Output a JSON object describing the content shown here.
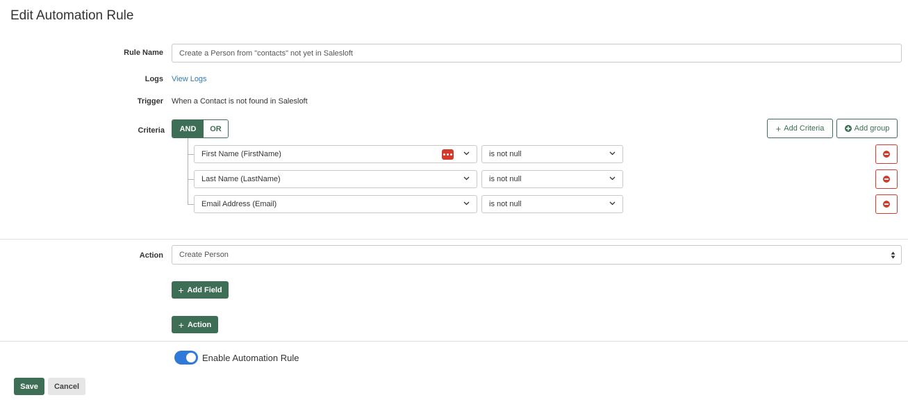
{
  "page": {
    "title": "Edit Automation Rule"
  },
  "rule_name": {
    "label": "Rule Name",
    "value": "Create a Person from \"contacts\" not yet in Salesloft"
  },
  "logs": {
    "label": "Logs",
    "link": "View Logs"
  },
  "trigger": {
    "label": "Trigger",
    "value": "When a Contact is not found in Salesloft"
  },
  "criteria": {
    "label": "Criteria",
    "and_label": "AND",
    "or_label": "OR",
    "selected_operator": "AND",
    "add_criteria_label": "Add Criteria",
    "add_group_label": "Add group",
    "rows": [
      {
        "field": "First Name (FirstName)",
        "condition": "is not null"
      },
      {
        "field": "Last Name (LastName)",
        "condition": "is not null"
      },
      {
        "field": "Email Address (Email)",
        "condition": "is not null"
      }
    ]
  },
  "action": {
    "label": "Action",
    "value": "Create Person",
    "add_field_label": "Add Field",
    "add_action_label": "Action"
  },
  "enable": {
    "label": "Enable Automation Rule",
    "enabled": true
  },
  "footer": {
    "save_label": "Save",
    "cancel_label": "Cancel"
  },
  "colors": {
    "primary": "#3e6e55",
    "danger": "#d33a2c",
    "link": "#2e7ab8",
    "toggle": "#2f7ad9"
  },
  "icons": {
    "add": "plus-icon",
    "add_group": "plus-circle-icon",
    "remove": "minus-circle-icon",
    "dropdown": "chevron-down-icon",
    "password_manager": "password-manager-icon"
  }
}
